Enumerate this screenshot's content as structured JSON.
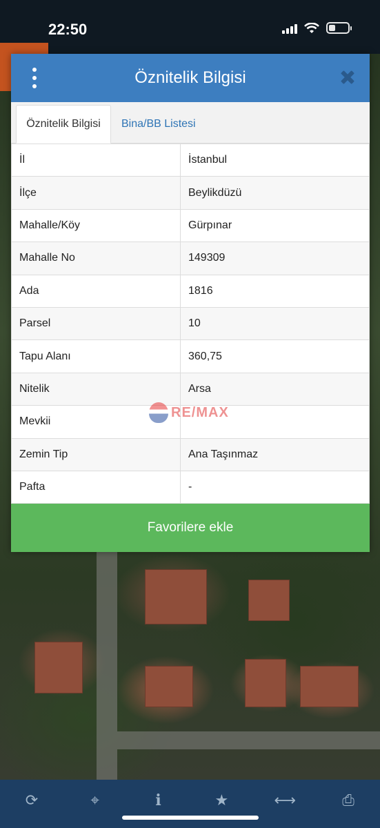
{
  "status_bar": {
    "time": "22:50"
  },
  "modal": {
    "title": "Öznitelik Bilgisi",
    "tabs": [
      {
        "label": "Öznitelik Bilgisi",
        "active": true
      },
      {
        "label": "Bina/BB Listesi",
        "active": false
      }
    ],
    "rows": [
      {
        "key": "İl",
        "value": "İstanbul"
      },
      {
        "key": "İlçe",
        "value": "Beylikdüzü"
      },
      {
        "key": "Mahalle/Köy",
        "value": "Gürpınar"
      },
      {
        "key": "Mahalle No",
        "value": "149309"
      },
      {
        "key": "Ada",
        "value": "1816"
      },
      {
        "key": "Parsel",
        "value": "10"
      },
      {
        "key": "Tapu Alanı",
        "value": "360,75"
      },
      {
        "key": "Nitelik",
        "value": "Arsa"
      },
      {
        "key": "Mevkii",
        "value": ""
      },
      {
        "key": "Zemin Tip",
        "value": "Ana Taşınmaz"
      },
      {
        "key": "Pafta",
        "value": "-"
      }
    ],
    "favorite_button_label": "Favorilere ekle"
  },
  "watermark": {
    "text": "RE/MAX"
  },
  "toolbar": {
    "icons": [
      "refresh-icon",
      "crosshair-icon",
      "info-icon",
      "star-icon",
      "measure-icon",
      "print-icon"
    ]
  },
  "colors": {
    "header": "#3d7ec0",
    "button": "#5cb85c",
    "toolbar": "#1d3e63",
    "tab_link": "#2e74b5"
  }
}
